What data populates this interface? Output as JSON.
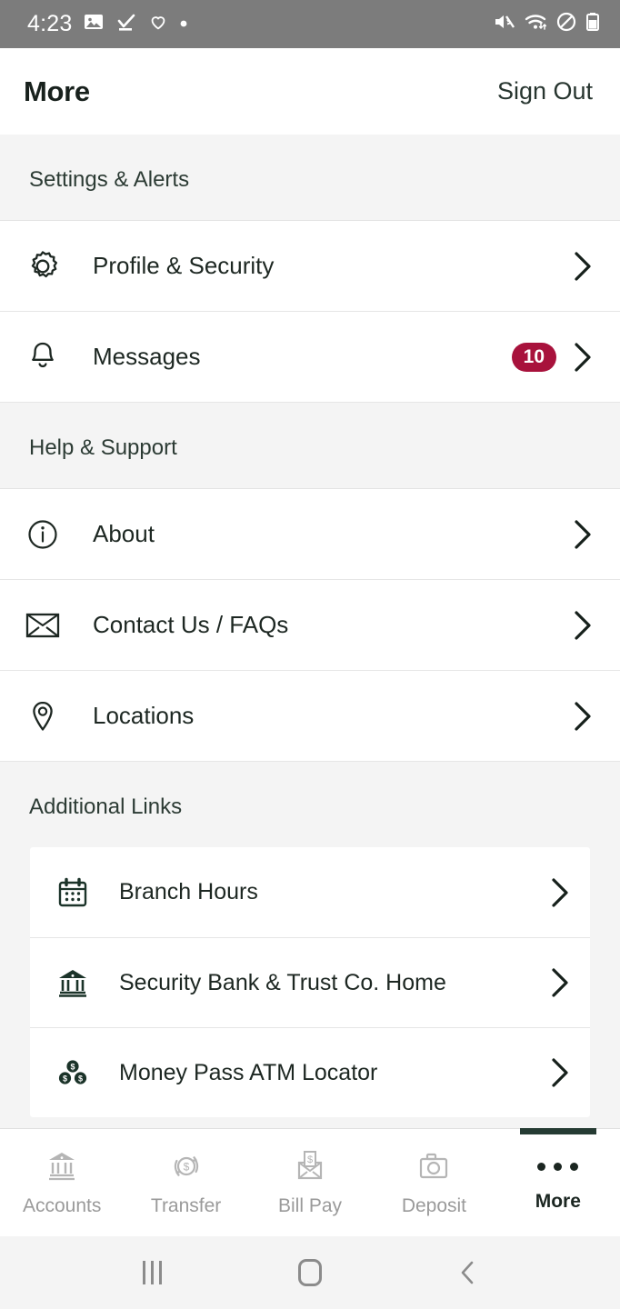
{
  "status_bar": {
    "time": "4:23",
    "left_icons": [
      "image-icon",
      "download-complete-icon",
      "heart-icon",
      "dot-icon"
    ],
    "right_icons": [
      "mute-icon",
      "wifi-icon",
      "do-not-disturb-icon",
      "battery-icon"
    ]
  },
  "header": {
    "title": "More",
    "sign_out_label": "Sign Out"
  },
  "sections": [
    {
      "header": "Settings & Alerts",
      "rows": [
        {
          "icon": "gear-icon",
          "label": "Profile & Security",
          "badge": ""
        },
        {
          "icon": "bell-icon",
          "label": "Messages",
          "badge": "10"
        }
      ]
    },
    {
      "header": "Help & Support",
      "rows": [
        {
          "icon": "info-circle-icon",
          "label": "About",
          "badge": ""
        },
        {
          "icon": "envelope-icon",
          "label": "Contact Us / FAQs",
          "badge": ""
        },
        {
          "icon": "map-pin-icon",
          "label": "Locations",
          "badge": ""
        }
      ]
    }
  ],
  "additional_links": {
    "header": "Additional Links",
    "rows": [
      {
        "icon": "calendar-icon",
        "label": "Branch Hours"
      },
      {
        "icon": "bank-icon",
        "label": "Security Bank & Trust Co. Home"
      },
      {
        "icon": "coins-dollar-icon",
        "label": "Money Pass ATM Locator"
      }
    ]
  },
  "tabbar": {
    "tabs": [
      {
        "icon": "bank-icon",
        "label": "Accounts",
        "active": false
      },
      {
        "icon": "transfer-circle-dollar-icon",
        "label": "Transfer",
        "active": false
      },
      {
        "icon": "envelope-dollar-icon",
        "label": "Bill Pay",
        "active": false
      },
      {
        "icon": "camera-icon",
        "label": "Deposit",
        "active": false
      },
      {
        "icon": "ellipsis-icon",
        "label": "More",
        "active": true
      }
    ]
  },
  "nav_bar": {
    "buttons": [
      "recents-icon",
      "home-icon",
      "back-icon"
    ]
  },
  "colors": {
    "badge_red": "#a8123c",
    "accent_green": "#253b33",
    "status_bar_gray": "#7c7c7c",
    "section_bg": "#f4f4f4"
  }
}
